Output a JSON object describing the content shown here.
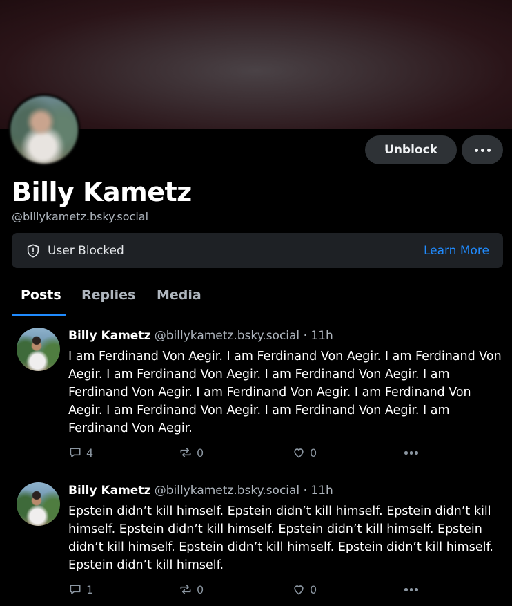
{
  "profile": {
    "display_name": "Billy Kametz",
    "handle": "@billykametz.bsky.social"
  },
  "buttons": {
    "unblock_label": "Unblock"
  },
  "blocked_notice": {
    "text": "User Blocked",
    "link": "Learn More"
  },
  "tabs": [
    {
      "label": "Posts"
    },
    {
      "label": "Replies"
    },
    {
      "label": "Media"
    }
  ],
  "posts": [
    {
      "author": "Billy Kametz",
      "handle": "@billykametz.bsky.social",
      "time": "· 11h",
      "text": "I am Ferdinand Von Aegir. I am Ferdinand Von Aegir. I am Ferdinand Von Aegir. I am Ferdinand Von Aegir. I am Ferdinand Von Aegir. I am Ferdinand Von Aegir. I am Ferdinand Von Aegir. I am Ferdinand Von Aegir. I am Ferdinand Von Aegir. I am Ferdinand Von Aegir. I am Ferdinand Von Aegir.",
      "replies": "4",
      "reposts": "0",
      "likes": "0"
    },
    {
      "author": "Billy Kametz",
      "handle": "@billykametz.bsky.social",
      "time": "· 11h",
      "text": "Epstein didn’t kill himself. Epstein didn’t kill himself. Epstein didn’t kill himself. Epstein didn’t kill himself. Epstein didn’t kill himself. Epstein didn’t kill himself. Epstein didn’t kill himself. Epstein didn’t kill himself. Epstein didn’t kill himself.",
      "replies": "1",
      "reposts": "0",
      "likes": "0"
    }
  ],
  "icons": {
    "shield": "shield-icon",
    "reply": "comment-icon",
    "repost": "repost-icon",
    "like": "heart-icon",
    "more": "more-icon"
  },
  "colors": {
    "accent": "#208bfe",
    "background": "#000000",
    "muted": "#aeb5bd"
  }
}
